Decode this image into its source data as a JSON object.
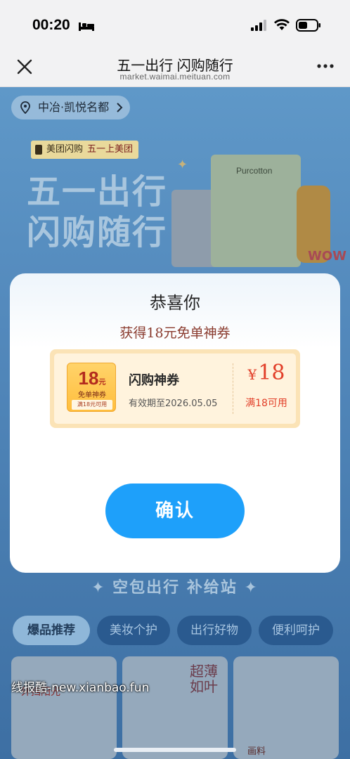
{
  "status_bar": {
    "time": "00:20"
  },
  "nav": {
    "title": "五一出行 闪购随行",
    "url": "market.waimai.meituan.com"
  },
  "background": {
    "location": "中冶·凯悦名都",
    "brand": "美团闪购",
    "brand_slogan": "五一上美团",
    "hero_title_line1": "五一出行",
    "hero_title_line2": "闪购随行",
    "product_brand": "Purcotton",
    "wow": "WOW",
    "section_title": "✦ 空包出行 补给站 ✦",
    "tabs": [
      {
        "label": "爆品推荐"
      },
      {
        "label": "美妆个护"
      },
      {
        "label": "出行好物"
      },
      {
        "label": "便利呵护"
      }
    ],
    "card_labels": [
      "外挡阳光",
      "超薄 如叶",
      "画料"
    ]
  },
  "modal": {
    "title": "恭喜你",
    "subtitle": "获得18元免单神券",
    "coupon": {
      "thumb_amount": "18",
      "thumb_unit": "元",
      "thumb_label": "免单神券",
      "thumb_condition": "满18元可用",
      "name": "闪购神券",
      "expiry": "有效期至2026.05.05",
      "currency": "¥",
      "value": "18",
      "min_spend": "满18可用"
    },
    "confirm_label": "确认"
  },
  "watermark": "线报酷-new.xianbao.fun",
  "colors": {
    "confirm": "#1ea0fa",
    "price": "#e2402a",
    "coupon_bg": "#fbe3b6"
  }
}
